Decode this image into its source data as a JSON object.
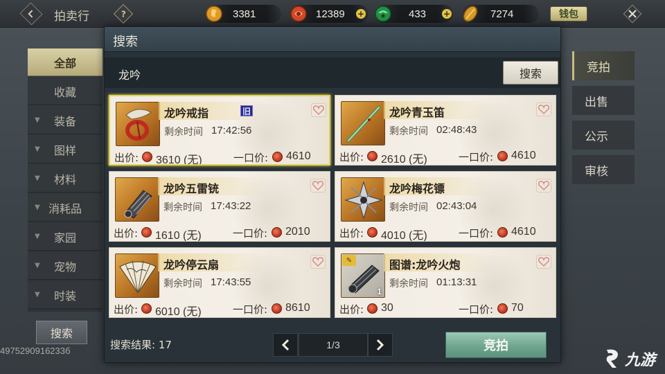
{
  "header": {
    "title": "拍卖行",
    "help_icon": "question-diamond-icon",
    "currencies": [
      {
        "name": "gold-token-icon",
        "value": "3381",
        "color": "#e0a030",
        "has_plus": false
      },
      {
        "name": "red-coin-icon",
        "value": "12389",
        "color": "#d0502c",
        "has_plus": true
      },
      {
        "name": "jade-icon",
        "value": "433",
        "color": "#2fa055",
        "has_plus": true
      },
      {
        "name": "gold-leaf-icon",
        "value": "7274",
        "color": "#d8a22c",
        "has_plus": false
      }
    ],
    "wallet_label": "钱包"
  },
  "sidebar": {
    "items": [
      {
        "label": "全部",
        "active": true,
        "expandable": false
      },
      {
        "label": "收藏",
        "active": false,
        "expandable": false
      },
      {
        "label": "装备",
        "active": false,
        "expandable": true
      },
      {
        "label": "图样",
        "active": false,
        "expandable": true
      },
      {
        "label": "材料",
        "active": false,
        "expandable": true
      },
      {
        "label": "消耗品",
        "active": false,
        "expandable": true
      },
      {
        "label": "家园",
        "active": false,
        "expandable": true
      },
      {
        "label": "宠物",
        "active": false,
        "expandable": true
      },
      {
        "label": "时装",
        "active": false,
        "expandable": true
      }
    ],
    "search_label": "搜索"
  },
  "player_id": "4975290916233б",
  "right_tabs": [
    {
      "label": "竞拍",
      "active": true
    },
    {
      "label": "出售",
      "active": false
    },
    {
      "label": "公示",
      "active": false
    },
    {
      "label": "审核",
      "active": false
    }
  ],
  "dialog": {
    "title": "搜索",
    "search_value": "龙吟",
    "search_button": "搜索",
    "time_label": "剩余时间",
    "bid_price_label": "出价:",
    "buyout_label": "一口价:",
    "old_badge": "旧",
    "items": [
      {
        "name": "龙吟戒指",
        "time": "17:42:56",
        "bid": "3610 (无)",
        "buyout": "4610",
        "selected": true,
        "badge": true,
        "qty": "",
        "recipe": false,
        "icon": "ring-icon"
      },
      {
        "name": "龙吟青玉笛",
        "time": "02:48:43",
        "bid": "2610 (无)",
        "buyout": "4610",
        "selected": false,
        "badge": false,
        "qty": "",
        "recipe": false,
        "icon": "flute-icon"
      },
      {
        "name": "龙吟五雷铳",
        "time": "17:43:22",
        "bid": "1610 (无)",
        "buyout": "2010",
        "selected": false,
        "badge": false,
        "qty": "",
        "recipe": false,
        "icon": "gauntlet-gun-icon"
      },
      {
        "name": "龙吟梅花镖",
        "time": "02:43:04",
        "bid": "4010 (无)",
        "buyout": "4610",
        "selected": false,
        "badge": false,
        "qty": "",
        "recipe": false,
        "icon": "shuriken-icon"
      },
      {
        "name": "龙吟停云扇",
        "time": "17:43:55",
        "bid": "6010 (无)",
        "buyout": "8610",
        "selected": false,
        "badge": false,
        "qty": "",
        "recipe": false,
        "icon": "fan-icon"
      },
      {
        "name": "图谱:龙吟火炮",
        "time": "01:13:31",
        "bid": "30",
        "buyout": "70",
        "selected": false,
        "badge": false,
        "qty": "1",
        "recipe": true,
        "icon": "cannon-blueprint-icon"
      }
    ],
    "result_label": "搜索结果: 17",
    "page_indicator": "1/3",
    "bid_button": "竞拍"
  },
  "watermark": "九游"
}
